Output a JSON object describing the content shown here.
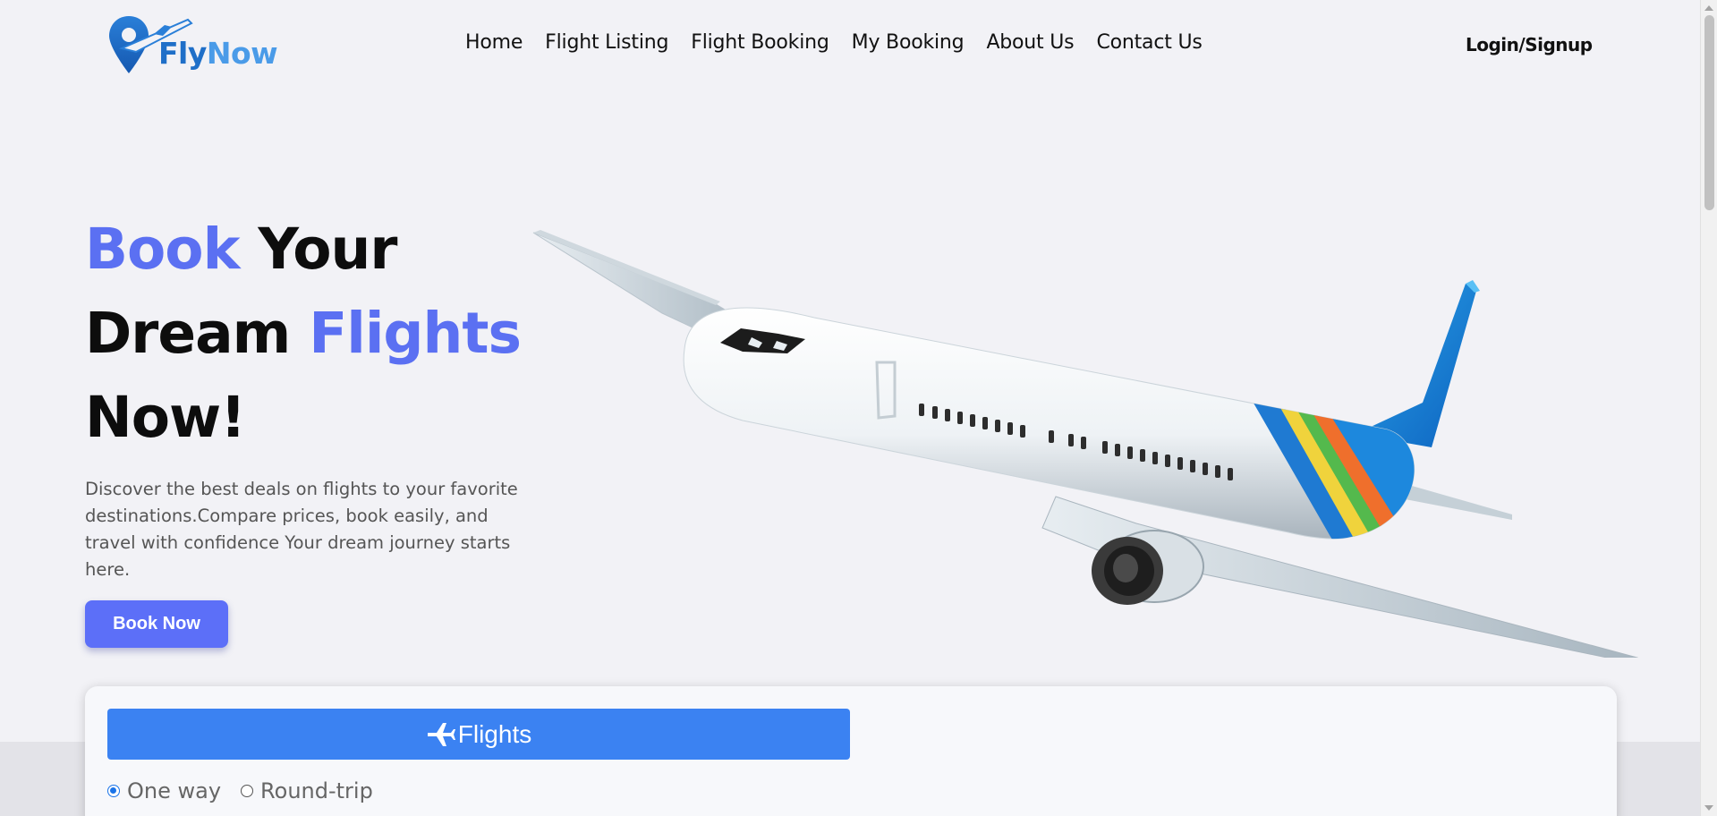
{
  "brand": {
    "name_part1": "Fly",
    "name_part2": "Now",
    "logo_icon": "location-pin-plane-icon"
  },
  "nav": {
    "items": [
      "Home",
      "Flight Listing",
      "Flight Booking",
      "My Booking",
      "About Us",
      "Contact Us"
    ],
    "login_label": "Login/Signup"
  },
  "hero": {
    "title_word1": "Book",
    "title_word2": " Your",
    "title_word3": "Dream ",
    "title_word4": "Flights",
    "title_word5": "Now!",
    "description": "Discover the best deals on flights to your favorite destinations.Compare prices, book easily, and travel with confidence Your dream journey starts here.",
    "cta_label": "Book Now",
    "image": "airplane-illustration"
  },
  "search": {
    "tab_label": "Flights",
    "tab_icon": "airplane-icon",
    "trip_types": [
      {
        "label": "One way",
        "checked": true
      },
      {
        "label": "Round-trip",
        "checked": false
      }
    ]
  },
  "colors": {
    "accent": "#5b70f2",
    "button": "#5c6ff8",
    "tab": "#3b82f2",
    "logo_dark": "#1f6fc8",
    "logo_light": "#4a9be8"
  }
}
